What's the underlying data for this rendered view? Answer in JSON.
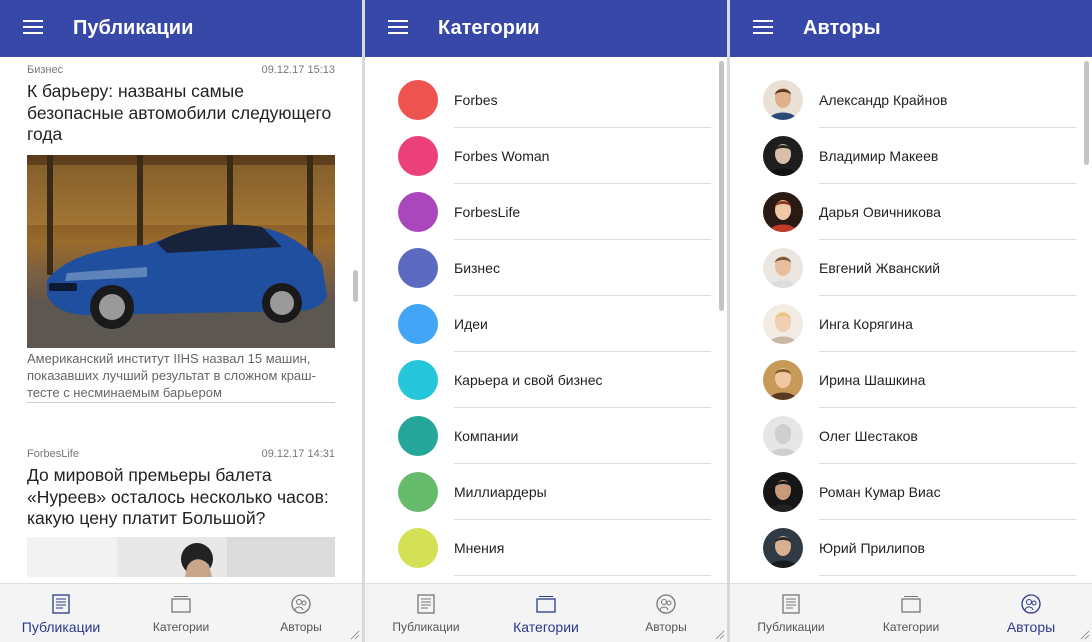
{
  "accent": "#3848a8",
  "nav": [
    {
      "label": "Публикации",
      "icon": "publications-icon"
    },
    {
      "label": "Категории",
      "icon": "categories-icon"
    },
    {
      "label": "Авторы",
      "icon": "authors-icon"
    }
  ],
  "panels": [
    {
      "title": "Публикации",
      "active_tab": "Публикации"
    },
    {
      "title": "Категории",
      "active_tab": "Категории"
    },
    {
      "title": "Авторы",
      "active_tab": "Авторы"
    }
  ],
  "articles": [
    {
      "category": "Бизнес",
      "date": "09.12.17 15:13",
      "title": "К барьеру: названы самые безопасные автомобили следующего года",
      "description": "Американский институт IIHS назвал 15 машин, показавших лучший результат в сложном краш-тесте с несминаемым барьером"
    },
    {
      "category": "ForbesLife",
      "date": "09.12.17 14:31",
      "title": "До мировой премьеры балета «Нуреев» осталось несколько часов: какую цену платит Большой?",
      "description": ""
    }
  ],
  "categories": [
    {
      "name": "Forbes",
      "color": "#ef5350"
    },
    {
      "name": "Forbes Woman",
      "color": "#ec407a"
    },
    {
      "name": "ForbesLife",
      "color": "#ab47bc"
    },
    {
      "name": "Бизнес",
      "color": "#5c6bc0"
    },
    {
      "name": "Идеи",
      "color": "#42a5f5"
    },
    {
      "name": "Карьера и свой бизнес",
      "color": "#26c6da"
    },
    {
      "name": "Компании",
      "color": "#26a69a"
    },
    {
      "name": "Миллиардеры",
      "color": "#66bb6a"
    },
    {
      "name": "Мнения",
      "color": "#d4e157"
    }
  ],
  "authors": [
    {
      "name": "Александр Крайнов"
    },
    {
      "name": "Владимир Макеев"
    },
    {
      "name": "Дарья Овичникова"
    },
    {
      "name": "Евгений Жванский"
    },
    {
      "name": "Инга Корягина"
    },
    {
      "name": "Ирина Шашкина"
    },
    {
      "name": "Олег Шестаков"
    },
    {
      "name": "Роман Кумар Виас"
    },
    {
      "name": "Юрий Прилипов"
    }
  ]
}
